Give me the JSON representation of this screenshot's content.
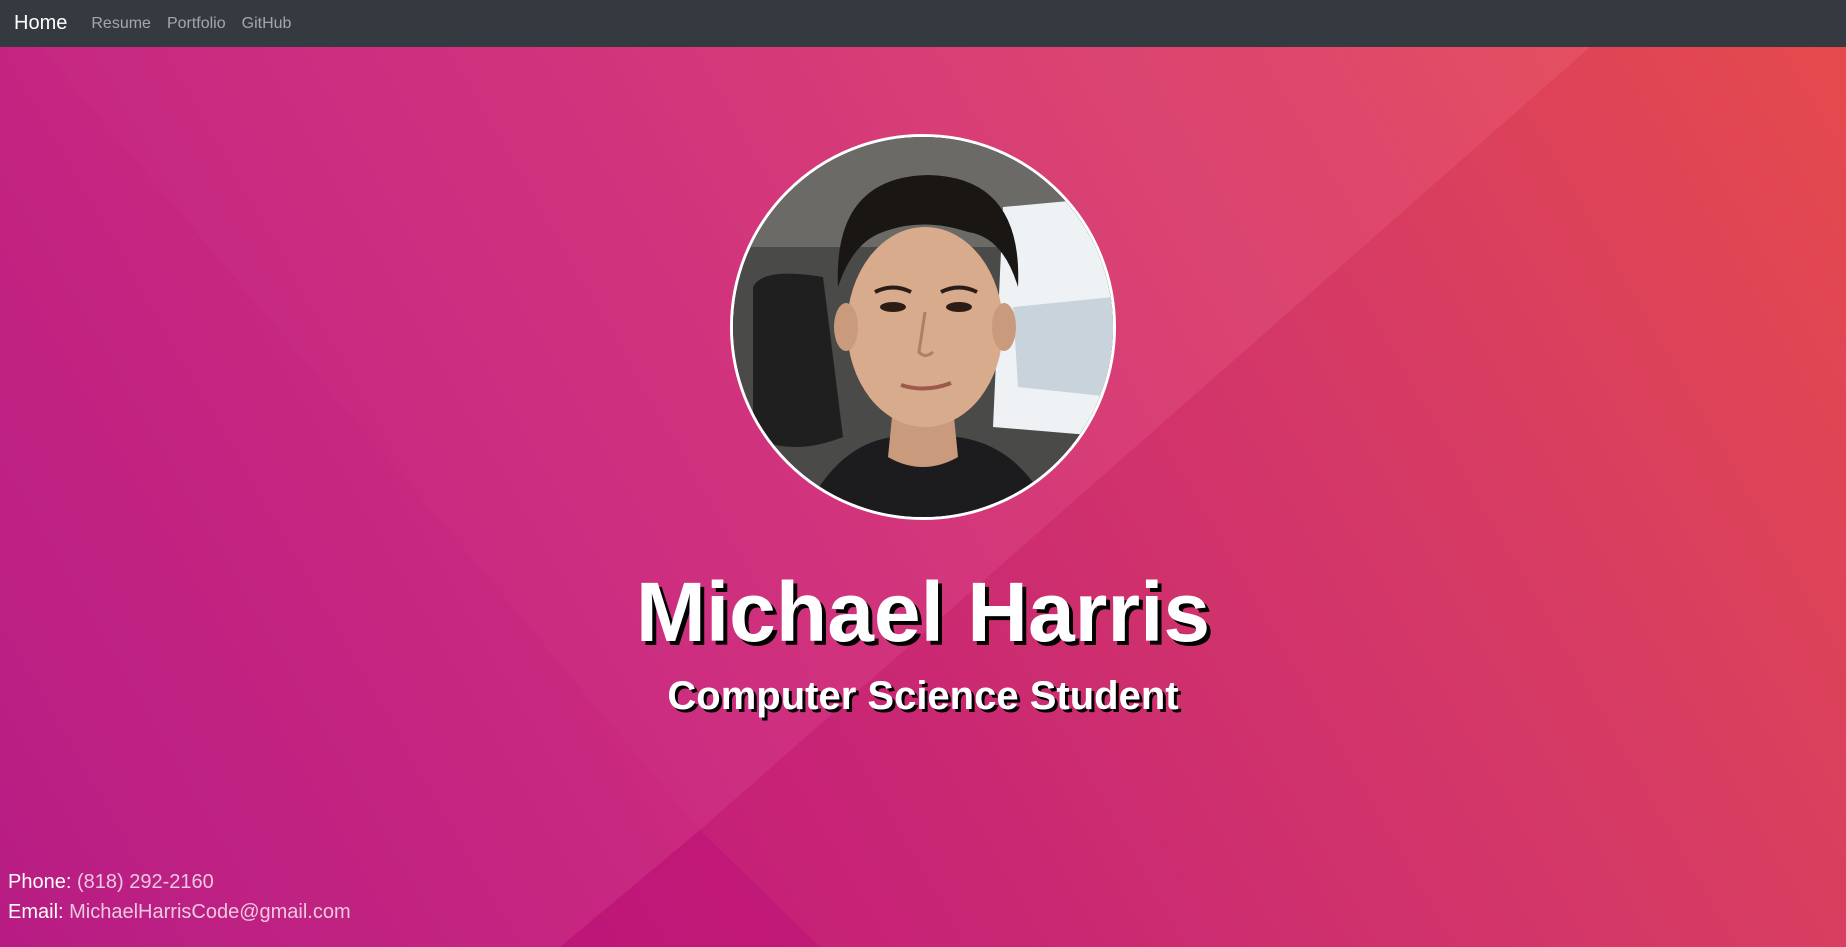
{
  "nav": {
    "brand": "Home",
    "links": [
      "Resume",
      "Portfolio",
      "GitHub"
    ]
  },
  "hero": {
    "avatar_alt": "profile-photo",
    "name": "Michael Harris",
    "subtitle": "Computer Science Student"
  },
  "contact": {
    "phone_label": "Phone:",
    "phone_value": "(818) 292-2160",
    "email_label": "Email:",
    "email_value": "MichaelHarrisCode@gmail.com"
  },
  "colors": {
    "navbar": "#343a40",
    "gradient_start": "#b5137f",
    "gradient_end": "#ea4d4d",
    "text": "#ffffff"
  }
}
